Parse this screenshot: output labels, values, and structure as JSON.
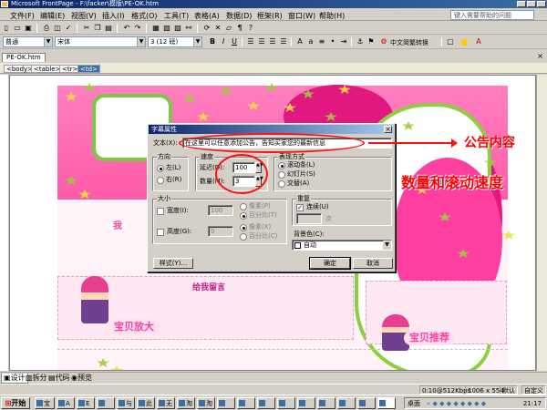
{
  "window": {
    "title": "Microsoft FrontPage - F:\\facker\\模版\\PE-OK.htm"
  },
  "menu": {
    "items": [
      "文件(F)",
      "编辑(E)",
      "视图(V)",
      "插入(I)",
      "格式(O)",
      "工具(T)",
      "表格(A)",
      "数据(D)",
      "框架(R)",
      "窗口(W)",
      "帮助(H)"
    ],
    "help_placeholder": "键入需要帮助的问题"
  },
  "formatting": {
    "style": "普通",
    "font": "宋体",
    "size": "3 (12 磅)",
    "convert": "中文简繁转换"
  },
  "document": {
    "tab": "PE-OK.htm",
    "tags": [
      "<body>",
      "<table>",
      "<tr>",
      "<td>"
    ]
  },
  "page": {
    "btn_guestbook": "给我留言",
    "banner_baby": "宝贝放大",
    "banner_recommend": "宝贝推荐",
    "side_char": "我"
  },
  "dialog": {
    "title": "字幕属性",
    "close": "×",
    "text_label": "文本(X):",
    "text_value": "在这里可以任意添加公告，告知买家您的最新信息",
    "direction": {
      "label": "方向",
      "left": "左(L)",
      "right": "右(R)",
      "selected": "left"
    },
    "speed": {
      "label": "速度",
      "delay_label": "延迟(D):",
      "delay": "100",
      "amount_label": "数量(M):",
      "amount": "3"
    },
    "behavior": {
      "label": "表现方式",
      "scroll": "滚动条(L)",
      "slide": "幻灯片(S)",
      "alternate": "交替(A)",
      "selected": "scroll"
    },
    "size": {
      "label": "大小",
      "width_label": "宽度(I):",
      "width_value": "100",
      "height_label": "高度(G):",
      "height_value": "0",
      "px1": "像素(P)",
      "pct1": "百分比(T)",
      "px2": "像素(X)",
      "pct2": "百分比(C)"
    },
    "repeat": {
      "label": "重复",
      "continuous": "连续(U)",
      "times": "次",
      "checked": true
    },
    "background": {
      "label": "背景色(C):",
      "value": "自动"
    },
    "buttons": {
      "style": "样式(Y)...",
      "ok": "确定",
      "cancel": "取消"
    }
  },
  "annotations": {
    "notice": "公告内容",
    "count_speed": "数量和滚动速度"
  },
  "views": {
    "design": "设计",
    "split": "拆分",
    "code": "代码",
    "preview": "预览"
  },
  "status": {
    "speed": "0:10@512Kbps",
    "size": "1006 x 554",
    "default": "默认",
    "custom": "自定义"
  },
  "taskbar": {
    "start": "开始",
    "tasks": [
      "宝",
      "A",
      "E",
      "",
      "与",
      "此",
      "无",
      "淘",
      "淘"
    ],
    "tray_label": "桌面",
    "clock": "21:17"
  },
  "colors": {
    "accent_red": "#ff0000",
    "title_blue": "#0a246a",
    "page_pink": "#ff5aa8",
    "leaf_green": "#9ccc3c"
  }
}
